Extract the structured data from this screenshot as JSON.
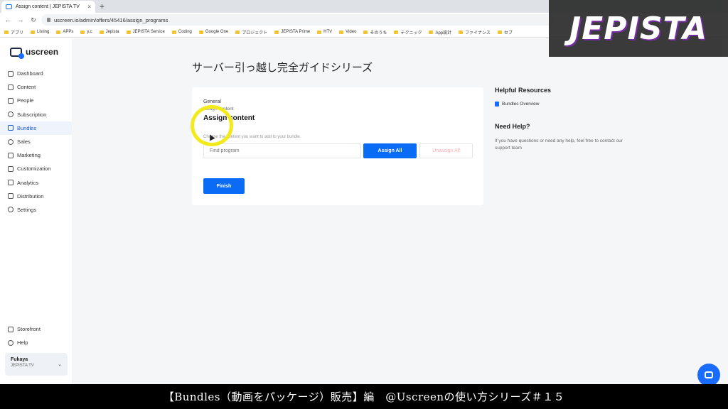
{
  "browser": {
    "tab_title": "Assign content | JEPISTA TV",
    "tab_close": "×",
    "new_tab": "+",
    "url": "uscreen.io/admin/offers/45416/assign_programs",
    "bookmarks": [
      "アプリ",
      "Listing",
      "APPs",
      "y.c",
      "Jepista",
      "JEPISTA Service",
      "Coding",
      "Google One",
      "プロジェクト",
      "JEPISTA Prime",
      "HTV",
      "Video",
      "そのうち",
      "テクニック",
      "App設計",
      "ファイナンス",
      "セブ"
    ]
  },
  "overlay": {
    "logo_text": "JEPISTA"
  },
  "sidebar": {
    "brand": "uscreen",
    "items": [
      {
        "label": "Dashboard",
        "icon": "grid-icon"
      },
      {
        "label": "Content",
        "icon": "folder-icon"
      },
      {
        "label": "People",
        "icon": "people-icon"
      },
      {
        "label": "Subscription",
        "icon": "refresh-icon"
      },
      {
        "label": "Bundles",
        "icon": "box-icon",
        "active": true
      },
      {
        "label": "Sales",
        "icon": "dollar-icon"
      },
      {
        "label": "Marketing",
        "icon": "megaphone-icon"
      },
      {
        "label": "Customization",
        "icon": "edit-icon"
      },
      {
        "label": "Analytics",
        "icon": "chart-icon"
      },
      {
        "label": "Distribution",
        "icon": "distribution-icon"
      },
      {
        "label": "Settings",
        "icon": "gear-icon"
      }
    ],
    "bottom_items": [
      {
        "label": "Storefront",
        "icon": "storefront-icon"
      },
      {
        "label": "Help",
        "icon": "help-icon"
      }
    ],
    "account": {
      "name": "Fukaya",
      "org": "JEPISTA TV"
    }
  },
  "main": {
    "page_title": "サーバー引っ越し完全ガイドシリーズ",
    "card": {
      "breadcrumb_1": "General",
      "breadcrumb_2": "Assign content",
      "title": "Assign content",
      "helper": "Choose the content you want to add to your bundle.",
      "search_placeholder": "Find program",
      "assign_all": "Assign All",
      "unassign_all": "Unassign All",
      "finish": "Finish"
    },
    "aside": {
      "resources_title": "Helpful Resources",
      "resource_link": "Bundles Overview",
      "help_title": "Need Help?",
      "help_text": "If you have questions or need any help, feel free to contact our support team"
    }
  },
  "caption": "【Bundles（動画をパッケージ）販売】編　@Uscreenの使い方シリーズ＃１５"
}
